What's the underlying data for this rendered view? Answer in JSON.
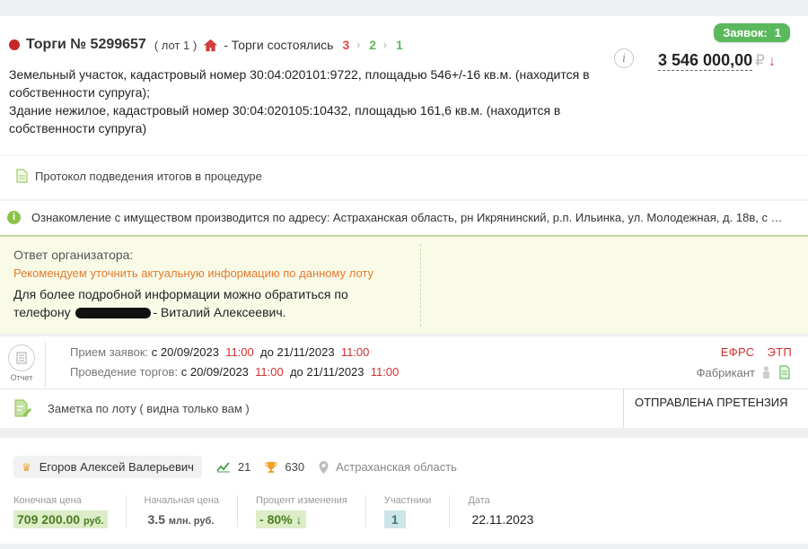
{
  "lot_card": {
    "bids_label": "Заявок:",
    "bids_count": "1",
    "title": "Торги № 5299657",
    "lot": "( лот 1 )",
    "status": "- Торги состоялись",
    "stages": [
      "3",
      "2",
      "1"
    ],
    "info_glyph": "i",
    "price": "3 546 000,00",
    "currency": "₽",
    "price_arrow": "↓",
    "description_line1": "Земельный участок, кадастровый номер 30:04:020101:9722, площадью 546+/-16 кв.м. (находится в собственности супруга);",
    "description_line2": "Здание нежилое, кадастровый номер 30:04:020105:10432, площадью 161,6 кв.м. (находится в собственности супруга)"
  },
  "protocol_link": "Протокол подведения итогов в процедуре",
  "notice": {
    "glyph": "i",
    "text": "Ознакомление с имуществом производится по адресу: Астраханская область, рн Икрянинский, р.п. Ильинка, ул. Молодежная, д. 18в, с …"
  },
  "organizer_reply": {
    "label": "Ответ организатора:",
    "recommendation": "Рекомендуем уточнить актуальную информацию по данному лоту",
    "text_before": "Для более подробной информации можно обратиться по телефону",
    "text_after": "- Виталий Алексеевич."
  },
  "dates": {
    "report_label": "Отчет",
    "apps_label": "Прием заявок:",
    "auction_label": "Проведение торгов:",
    "from_word": "с",
    "to_word": "до",
    "apps_from_date": "20/09/2023",
    "apps_from_time": "11:00",
    "apps_to_date": "21/11/2023",
    "apps_to_time": "11:00",
    "auction_from_date": "20/09/2023",
    "auction_from_time": "11:00",
    "auction_to_date": "21/11/2023",
    "auction_to_time": "11:00",
    "efrs": "ЕФРС",
    "etp": "ЭТП",
    "platform": "Фабрикант",
    "note_label": "Заметка по лоту ( видна только вам )",
    "claim_status": "ОТПРАВЛЕНА ПРЕТЕНЗИЯ"
  },
  "winner": {
    "crown_glyph": "♛",
    "name": "Егоров Алексей Валерьевич",
    "trades_count": "21",
    "wins_count": "630",
    "region": "Астраханская область",
    "final_price_label": "Конечная цена",
    "final_price": "709 200.00",
    "final_price_unit": "руб.",
    "start_price_label": "Начальная цена",
    "start_price": "3.5",
    "start_price_unit": "млн. руб.",
    "change_label": "Процент изменения",
    "change_value": "- 80%",
    "change_arrow": "↓",
    "participants_label": "Участники",
    "participants": "1",
    "date_label": "Дата",
    "date": "22.11.2023"
  },
  "colors": {
    "accent_green": "#5cb85c",
    "alert_red": "#d32f2f",
    "warn_orange": "#e27a2f"
  }
}
